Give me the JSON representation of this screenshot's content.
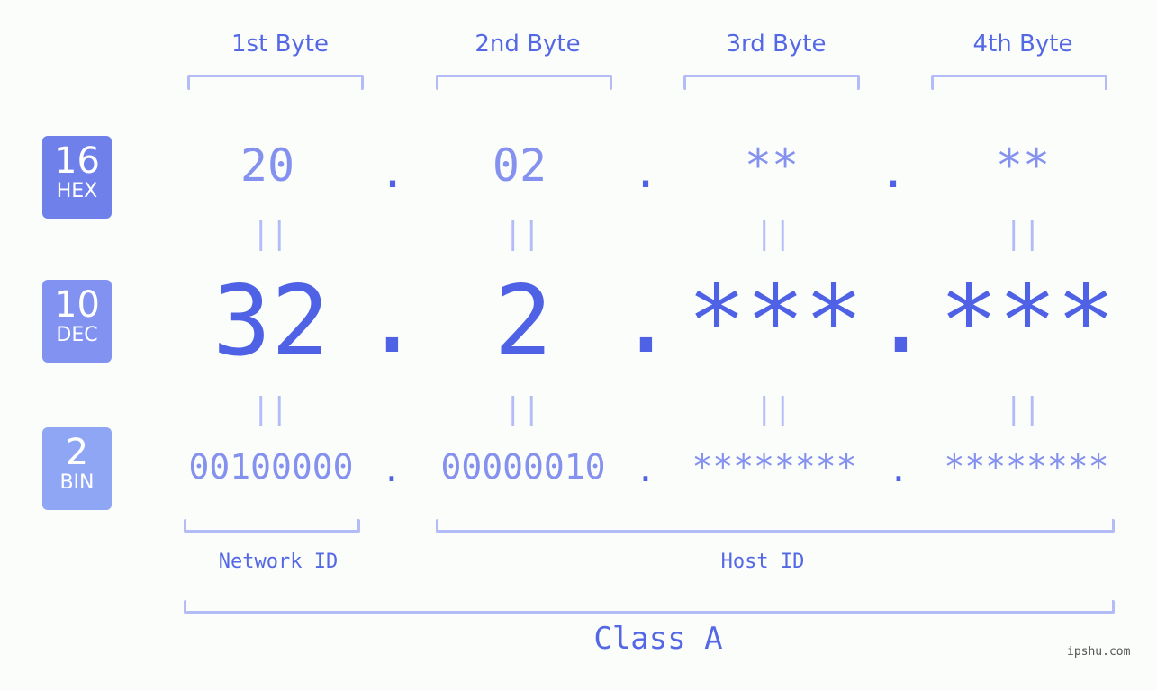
{
  "headers": [
    "1st Byte",
    "2nd Byte",
    "3rd Byte",
    "4th Byte"
  ],
  "badges": [
    {
      "number": "16",
      "label": "HEX",
      "color": "#6f80ea"
    },
    {
      "number": "10",
      "label": "DEC",
      "color": "#8192f0"
    },
    {
      "number": "2",
      "label": "BIN",
      "color": "#8fa6f5"
    }
  ],
  "hex": [
    "20",
    "02",
    "**",
    "**"
  ],
  "dec": [
    "32",
    "2",
    "***",
    "***"
  ],
  "bin": [
    "00100000",
    "00000010",
    "********",
    "********"
  ],
  "separator": ".",
  "equals": "||",
  "network_label": "Network ID",
  "host_label": "Host ID",
  "class_label": "Class A",
  "watermark": "ipshu.com"
}
